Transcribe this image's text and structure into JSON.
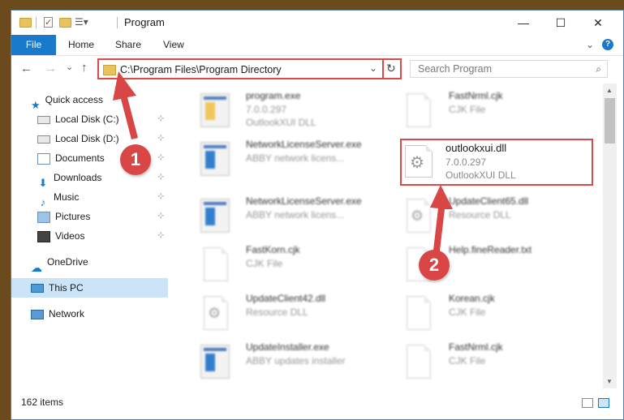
{
  "window": {
    "title": "Program",
    "controls": {
      "minimize": "—",
      "maximize": "☐",
      "close": "✕"
    }
  },
  "ribbon": {
    "tabs": [
      {
        "label": "File"
      },
      {
        "label": "Home"
      },
      {
        "label": "Share"
      },
      {
        "label": "View"
      }
    ],
    "help": "?",
    "expand": "⌄"
  },
  "navbar": {
    "back": "←",
    "forward": "→",
    "recent": "⌄",
    "up": "↑",
    "address": "C:\\Program Files\\Program Directory",
    "address_dropdown": "⌄",
    "refresh": "↻",
    "search_placeholder": "Search Program",
    "search_icon": "⌕"
  },
  "sidebar": {
    "quick_access": "Quick access",
    "items": [
      {
        "label": "Local Disk (C:)",
        "icon": "drive-icon",
        "pinned": true
      },
      {
        "label": "Local Disk (D:)",
        "icon": "drive-icon",
        "pinned": true
      },
      {
        "label": "Documents",
        "icon": "documents-icon",
        "pinned": true
      },
      {
        "label": "Downloads",
        "icon": "downloads-icon",
        "pinned": true
      },
      {
        "label": "Music",
        "icon": "music-icon",
        "pinned": true
      },
      {
        "label": "Pictures",
        "icon": "pictures-icon",
        "pinned": true
      },
      {
        "label": "Videos",
        "icon": "videos-icon",
        "pinned": true
      }
    ],
    "onedrive": "OneDrive",
    "this_pc": "This PC",
    "network": "Network",
    "pin_glyph": "📌"
  },
  "files": [
    {
      "name": "program.exe",
      "line2": "7.0.0.297",
      "line3": "OutlookXUI DLL",
      "icon": "exe-icon"
    },
    {
      "name": "FastNrml.cjk",
      "line2": "CJK File",
      "line3": "",
      "icon": "document-icon"
    },
    {
      "name": "NetworkLicenseServer.exe",
      "line2": "ABBY network licens...",
      "line3": "",
      "icon": "app-window-icon"
    },
    {
      "name": "outlookxui.dll",
      "line2": "7.0.0.297",
      "line3": "OutlookXUI DLL",
      "icon": "dll-gear-icon"
    },
    {
      "name": "NetworkLicenseServer.exe",
      "line2": "ABBY network licens...",
      "line3": "",
      "icon": "app-window-icon"
    },
    {
      "name": "UpdateClient65.dll",
      "line2": "Resource DLL",
      "line3": "",
      "icon": "dll-gear-icon"
    },
    {
      "name": "FastKorn.cjk",
      "line2": "CJK File",
      "line3": "",
      "icon": "document-icon"
    },
    {
      "name": "Help.fineReader.txt",
      "line2": "",
      "line3": "",
      "icon": "document-icon"
    },
    {
      "name": "UpdateClient42.dll",
      "line2": "Resource DLL",
      "line3": "",
      "icon": "dll-gear-icon"
    },
    {
      "name": "Korean.cjk",
      "line2": "CJK File",
      "line3": "",
      "icon": "document-icon"
    },
    {
      "name": "UpdateInstaller.exe",
      "line2": "ABBY updates installer",
      "line3": "",
      "icon": "app-window-icon"
    },
    {
      "name": "FastNrml.cjk",
      "line2": "CJK File",
      "line3": "",
      "icon": "document-icon"
    }
  ],
  "status": {
    "count": "162 items"
  },
  "annotations": {
    "step1": "1",
    "step2": "2"
  },
  "colors": {
    "accent": "#1979ca",
    "highlight": "#d94a4a",
    "selection": "#cce4f7"
  }
}
